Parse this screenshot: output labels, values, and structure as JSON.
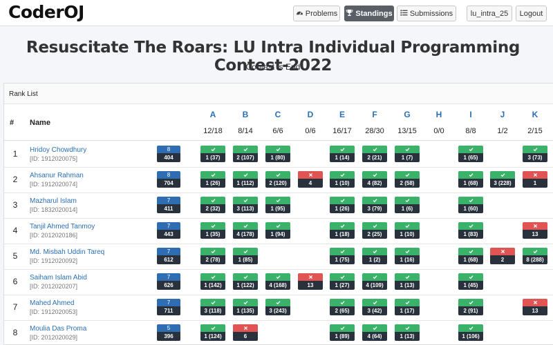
{
  "brand": "CoderOJ",
  "nav": {
    "problems": "Problems",
    "standings": "Standings",
    "submissions": "Submissions",
    "user": "lu_intra_25",
    "logout": "Logout"
  },
  "contest": {
    "title": "Resuscitate The Roars: LU Intra Individual Programming Contest-2022",
    "status": "Contest Is End"
  },
  "rank_list_label": "Rank List",
  "table": {
    "rank_header": "#",
    "name_header": "Name",
    "problems": [
      {
        "letter": "A",
        "stat": "12/18"
      },
      {
        "letter": "B",
        "stat": "8/14"
      },
      {
        "letter": "C",
        "stat": "6/6"
      },
      {
        "letter": "D",
        "stat": "0/6"
      },
      {
        "letter": "E",
        "stat": "16/17"
      },
      {
        "letter": "F",
        "stat": "28/30"
      },
      {
        "letter": "G",
        "stat": "13/15"
      },
      {
        "letter": "H",
        "stat": "0/0"
      },
      {
        "letter": "I",
        "stat": "8/8"
      },
      {
        "letter": "J",
        "stat": "1/2"
      },
      {
        "letter": "K",
        "stat": "2/15"
      }
    ],
    "rows": [
      {
        "rank": "1",
        "name": "Hridoy Chowdhury",
        "id": "[ID: 1912020075]",
        "solved": "8",
        "penalty": "404",
        "cells": [
          {
            "s": "ac",
            "t": "1 (37)"
          },
          {
            "s": "ac",
            "t": "2 (107)"
          },
          {
            "s": "ac",
            "t": "1 (80)"
          },
          null,
          {
            "s": "ac",
            "t": "1 (14)"
          },
          {
            "s": "ac",
            "t": "2 (21)"
          },
          {
            "s": "ac",
            "t": "1 (7)"
          },
          null,
          {
            "s": "ac",
            "t": "1 (65)"
          },
          null,
          {
            "s": "ac",
            "t": "3 (73)"
          }
        ]
      },
      {
        "rank": "2",
        "name": "Ahsanur Rahman",
        "id": "[ID: 1912020074]",
        "solved": "8",
        "penalty": "704",
        "cells": [
          {
            "s": "ac",
            "t": "1 (26)"
          },
          {
            "s": "ac",
            "t": "1 (112)"
          },
          {
            "s": "ac",
            "t": "2 (120)"
          },
          {
            "s": "wa",
            "t": "4"
          },
          {
            "s": "ac",
            "t": "1 (10)"
          },
          {
            "s": "ac",
            "t": "4 (82)"
          },
          {
            "s": "ac",
            "t": "2 (58)"
          },
          null,
          {
            "s": "ac",
            "t": "1 (68)"
          },
          {
            "s": "ac",
            "t": "3 (228)"
          },
          {
            "s": "wa",
            "t": "1"
          }
        ]
      },
      {
        "rank": "3",
        "name": "Mazharul Islam",
        "id": "[ID: 1832020014]",
        "solved": "7",
        "penalty": "411",
        "cells": [
          {
            "s": "ac",
            "t": "2 (32)"
          },
          {
            "s": "ac",
            "t": "3 (113)"
          },
          {
            "s": "ac",
            "t": "1 (95)"
          },
          null,
          {
            "s": "ac",
            "t": "1 (26)"
          },
          {
            "s": "ac",
            "t": "3 (79)"
          },
          {
            "s": "ac",
            "t": "1 (6)"
          },
          null,
          {
            "s": "ac",
            "t": "1 (60)"
          },
          null,
          null
        ]
      },
      {
        "rank": "4",
        "name": "Tanjil Ahmed Tanmoy",
        "id": "[ID: 2012020186]",
        "solved": "7",
        "penalty": "443",
        "cells": [
          {
            "s": "ac",
            "t": "1 (35)"
          },
          {
            "s": "ac",
            "t": "4 (178)"
          },
          {
            "s": "ac",
            "t": "1 (94)"
          },
          null,
          {
            "s": "ac",
            "t": "1 (18)"
          },
          {
            "s": "ac",
            "t": "2 (25)"
          },
          {
            "s": "ac",
            "t": "1 (10)"
          },
          null,
          {
            "s": "ac",
            "t": "1 (83)"
          },
          null,
          {
            "s": "wa",
            "t": "13"
          }
        ]
      },
      {
        "rank": "5",
        "name": "Md. Misbah Uddin Tareq",
        "id": "[ID: 1912020092]",
        "solved": "7",
        "penalty": "612",
        "cells": [
          {
            "s": "ac",
            "t": "2 (78)"
          },
          {
            "s": "ac",
            "t": "1 (85)"
          },
          null,
          null,
          {
            "s": "ac",
            "t": "1 (75)"
          },
          {
            "s": "ac",
            "t": "1 (2)"
          },
          {
            "s": "ac",
            "t": "1 (16)"
          },
          null,
          {
            "s": "ac",
            "t": "1 (68)"
          },
          {
            "s": "wa",
            "t": "2"
          },
          {
            "s": "ac",
            "t": "8 (288)"
          }
        ]
      },
      {
        "rank": "6",
        "name": "Saiham Islam Abid",
        "id": "[ID: 2012020207]",
        "solved": "7",
        "penalty": "626",
        "cells": [
          {
            "s": "ac",
            "t": "1 (142)"
          },
          {
            "s": "ac",
            "t": "1 (122)"
          },
          {
            "s": "ac",
            "t": "4 (168)"
          },
          {
            "s": "wa",
            "t": "13"
          },
          {
            "s": "ac",
            "t": "1 (27)"
          },
          {
            "s": "ac",
            "t": "4 (109)"
          },
          {
            "s": "ac",
            "t": "1 (13)"
          },
          null,
          {
            "s": "ac",
            "t": "1 (45)"
          },
          null,
          null
        ]
      },
      {
        "rank": "7",
        "name": "Mahed Ahmed",
        "id": "[ID: 1912020053]",
        "solved": "7",
        "penalty": "711",
        "cells": [
          {
            "s": "ac",
            "t": "3 (118)"
          },
          {
            "s": "ac",
            "t": "1 (135)"
          },
          {
            "s": "ac",
            "t": "3 (243)"
          },
          null,
          {
            "s": "ac",
            "t": "2 (65)"
          },
          {
            "s": "ac",
            "t": "3 (42)"
          },
          {
            "s": "ac",
            "t": "1 (17)"
          },
          null,
          {
            "s": "ac",
            "t": "2 (91)"
          },
          null,
          {
            "s": "wa",
            "t": "13"
          }
        ]
      },
      {
        "rank": "8",
        "name": "Moulia Das Proma",
        "id": "[ID: 2012020029]",
        "solved": "5",
        "penalty": "396",
        "cells": [
          {
            "s": "ac",
            "t": "1 (124)"
          },
          {
            "s": "wa",
            "t": "6"
          },
          null,
          null,
          {
            "s": "ac",
            "t": "1 (89)"
          },
          {
            "s": "ac",
            "t": "4 (64)"
          },
          {
            "s": "ac",
            "t": "1 (13)"
          },
          null,
          {
            "s": "ac",
            "t": "1 (106)"
          },
          null,
          null
        ]
      }
    ]
  },
  "colors": {
    "accepted": "#3ab26a",
    "wrong": "#e05454",
    "solved_badge": "#2f6db3",
    "cell_dark": "#28313c",
    "link": "#2a6fb5"
  }
}
